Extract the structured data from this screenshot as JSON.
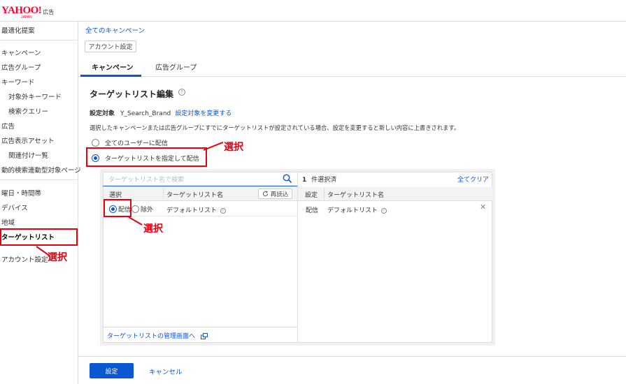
{
  "header": {
    "logo": "YAHOO!",
    "logo_japan": "JAPAN",
    "logo_sub": "広告"
  },
  "sidebar": {
    "items": [
      "最適化提案",
      "キャンペーン",
      "広告グループ",
      "キーワード",
      "対象外キーワード",
      "検索クエリー",
      "広告",
      "広告表示アセット",
      "関連付け一覧",
      "動的検索連動型対象ページ",
      "曜日・時間帯",
      "デバイス",
      "地域",
      "ターゲットリスト",
      "アカウント設定"
    ]
  },
  "breadcrumb": "全てのキャンペーン",
  "account_button": "アカウント設定",
  "tabs": [
    "キャンペーン",
    "広告グループ"
  ],
  "page_title": "ターゲットリスト編集",
  "target": {
    "label": "設定対象",
    "value": "Y_Search_Brand",
    "change_link": "設定対象を変更する"
  },
  "notice": "選択したキャンペーンまたは広告グループにすでにターゲットリストが設定されている場合、設定を変更すると新しい内容に上書きされます。",
  "radios": [
    {
      "label": "全てのユーザーに配信",
      "selected": false
    },
    {
      "label": "ターゲットリストを指定して配信",
      "selected": true
    }
  ],
  "left_panel": {
    "search_placeholder": "ターゲットリスト名で検索",
    "col_select": "選択",
    "col_name": "ターゲットリスト名",
    "reload": "再読込",
    "row": {
      "deliver": "配信",
      "exclude": "除外",
      "name": "デフォルトリスト"
    },
    "mgmt_link": "ターゲットリストの管理画面へ"
  },
  "right_panel": {
    "count": "1",
    "count_suffix": "件選択済",
    "clear_all": "全てクリア",
    "col_setting": "設定",
    "col_name": "ターゲットリスト名",
    "row": {
      "setting": "配信",
      "name": "デフォルトリスト"
    }
  },
  "annotation": "選択",
  "footer": {
    "submit": "設定",
    "cancel": "キャンセル"
  },
  "colors": {
    "accent": "#0b57d0",
    "annotation": "#e60012"
  }
}
